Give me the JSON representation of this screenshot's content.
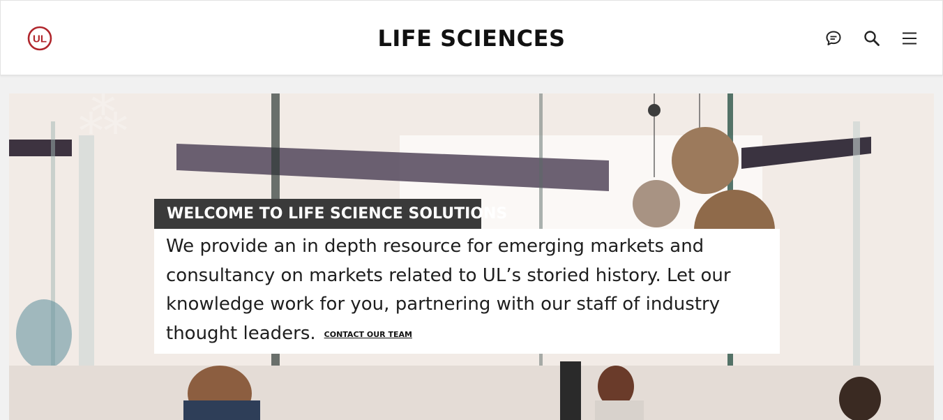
{
  "header": {
    "brand": "UL",
    "title": "LIFE SCIENCES",
    "icons": {
      "chat": "chat-bubble-icon",
      "search": "search-icon",
      "menu": "hamburger-menu-icon"
    }
  },
  "hero": {
    "tag": "WELCOME TO LIFE SCIENCE SOLUTIONS",
    "description": "We provide an in depth resource for emerging markets and consultancy on markets related to UL’s storied history. Let our knowledge work for you, partnering with our staff of industry thought leaders.",
    "cta": "CONTACT OUR TEAM"
  },
  "colors": {
    "brand_red": "#b0262c",
    "tag_background": "#3a3a3a",
    "text": "#1e1e1e"
  }
}
